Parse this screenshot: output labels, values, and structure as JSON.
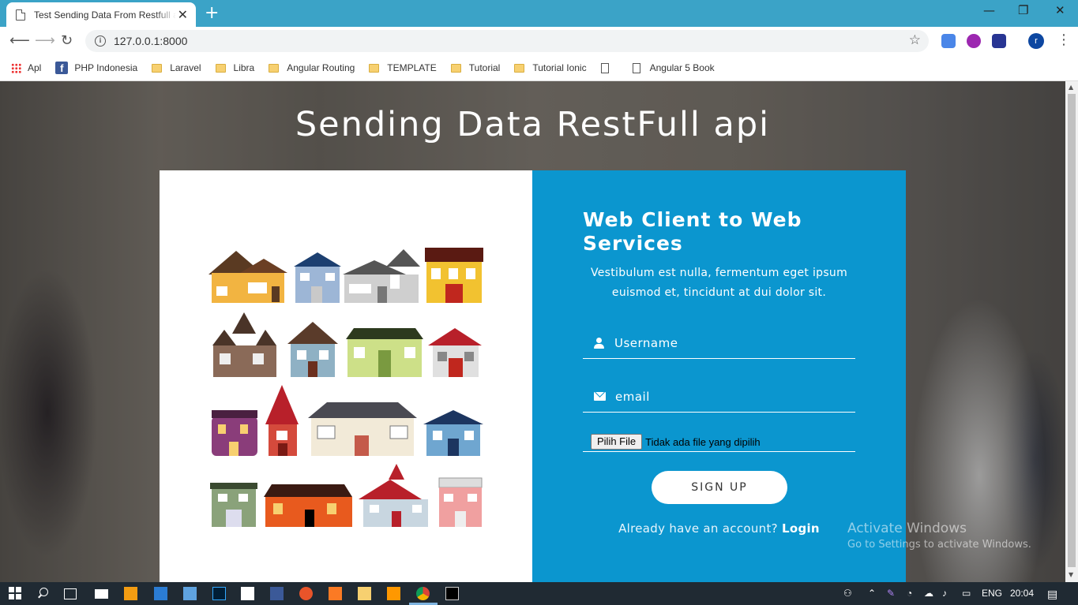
{
  "browser": {
    "tab_title": "Test Sending Data From Restfull api",
    "tab_close": "✕",
    "new_tab": "+",
    "url": "127.0.0.1:8000",
    "profile_initial": "r",
    "window_controls": [
      "—",
      "❐",
      "✕"
    ]
  },
  "bookmarks": [
    {
      "label": "Apl",
      "icon": "apps-icon"
    },
    {
      "label": "PHP Indonesia",
      "icon": "facebook-icon"
    },
    {
      "label": "Laravel",
      "icon": "folder-icon"
    },
    {
      "label": "Libra",
      "icon": "folder-icon"
    },
    {
      "label": "Angular Routing",
      "icon": "folder-icon"
    },
    {
      "label": "TEMPLATE",
      "icon": "folder-icon"
    },
    {
      "label": "Tutorial",
      "icon": "folder-icon"
    },
    {
      "label": "Tutorial Ionic",
      "icon": "folder-icon"
    },
    {
      "label": "",
      "icon": "page-icon"
    },
    {
      "label": "Angular 5 Book",
      "icon": "page-icon"
    }
  ],
  "page": {
    "hero_title": "Sending Data RestFull api",
    "form": {
      "title": "Web Client to Web Services",
      "description": "Vestibulum est nulla, fermentum eget ipsum euismod et, tincidunt at dui dolor sit.",
      "username_placeholder": "Username",
      "email_placeholder": "email",
      "file_button": "Pilih File",
      "file_status": "Tidak ada file yang dipilih",
      "submit_label": "SIGN UP",
      "account_prompt": "Already have an account?",
      "login_label": "Login"
    },
    "colors": {
      "form_panel": "#0b96cf",
      "chrome_titlebar": "#3ba3c7"
    }
  },
  "watermark": {
    "line1": "Activate Windows",
    "line2": "Go to Settings to activate Windows."
  },
  "taskbar": {
    "language": "ENG",
    "time": "20:04"
  }
}
